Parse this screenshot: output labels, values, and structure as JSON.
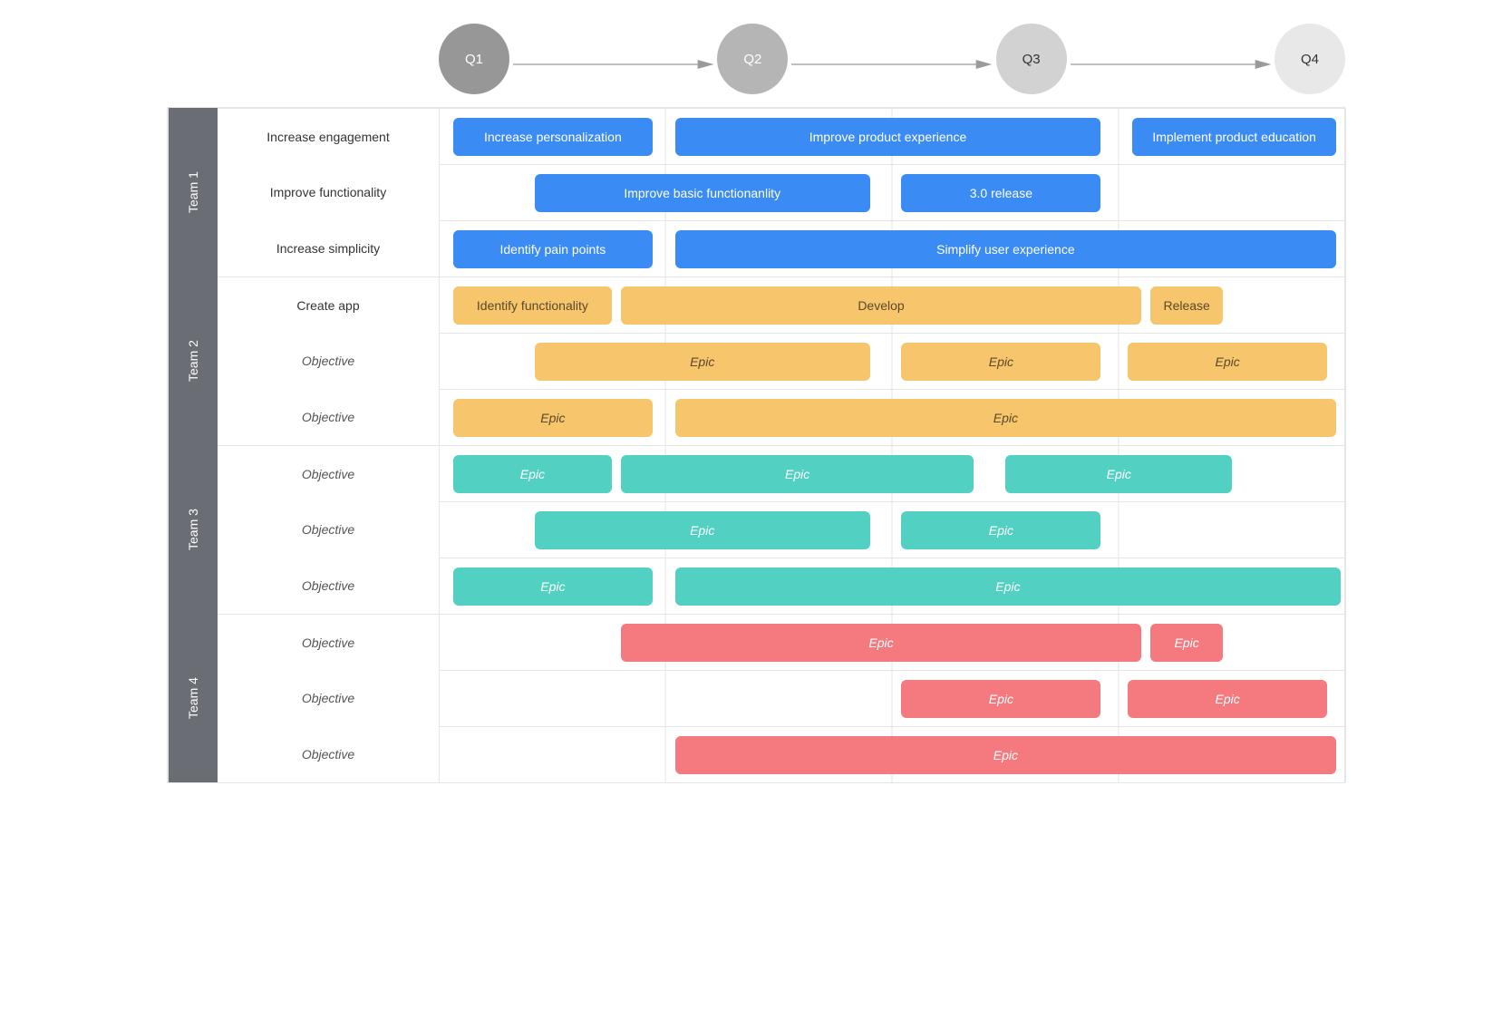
{
  "quarters": [
    "Q1",
    "Q2",
    "Q3",
    "Q4"
  ],
  "teams": [
    {
      "name": "Team 1",
      "color": "c-blue",
      "rows": [
        {
          "objective": "Increase engagement",
          "italic": false,
          "alt": true,
          "epics": [
            {
              "label": "Increase personalization",
              "start": 0.015,
              "span": 0.22,
              "italic": false
            },
            {
              "label": "Improve product experience",
              "start": 0.26,
              "span": 0.47,
              "italic": false
            },
            {
              "label": "Implement product education",
              "start": 0.765,
              "span": 0.225,
              "italic": false
            }
          ]
        },
        {
          "objective": "Improve functionality",
          "italic": false,
          "alt": false,
          "epics": [
            {
              "label": "Improve basic functionanlity",
              "start": 0.105,
              "span": 0.37,
              "italic": false
            },
            {
              "label": "3.0 release",
              "start": 0.51,
              "span": 0.22,
              "italic": false
            }
          ]
        },
        {
          "objective": "Increase simplicity",
          "italic": false,
          "alt": true,
          "epics": [
            {
              "label": "Identify pain points",
              "start": 0.015,
              "span": 0.22,
              "italic": false
            },
            {
              "label": "Simplify user experience",
              "start": 0.26,
              "span": 0.73,
              "italic": false
            }
          ]
        }
      ]
    },
    {
      "name": "Team 2",
      "color": "c-yellow",
      "rows": [
        {
          "objective": "Create app",
          "italic": false,
          "alt": false,
          "epics": [
            {
              "label": "Identify functionality",
              "start": 0.015,
              "span": 0.175,
              "italic": false
            },
            {
              "label": "Develop",
              "start": 0.2,
              "span": 0.575,
              "italic": false
            },
            {
              "label": "Release",
              "start": 0.785,
              "span": 0.08,
              "italic": false
            }
          ]
        },
        {
          "objective": "Objective",
          "italic": true,
          "alt": true,
          "epics": [
            {
              "label": "Epic",
              "start": 0.105,
              "span": 0.37,
              "italic": true
            },
            {
              "label": "Epic",
              "start": 0.51,
              "span": 0.22,
              "italic": true
            },
            {
              "label": "Epic",
              "start": 0.76,
              "span": 0.22,
              "italic": true
            }
          ]
        },
        {
          "objective": "Objective",
          "italic": true,
          "alt": false,
          "epics": [
            {
              "label": "Epic",
              "start": 0.015,
              "span": 0.22,
              "italic": true
            },
            {
              "label": "Epic",
              "start": 0.26,
              "span": 0.73,
              "italic": true
            }
          ]
        }
      ]
    },
    {
      "name": "Team 3",
      "color": "c-teal",
      "rows": [
        {
          "objective": "Objective",
          "italic": true,
          "alt": true,
          "epics": [
            {
              "label": "Epic",
              "start": 0.015,
              "span": 0.175,
              "italic": true
            },
            {
              "label": "Epic",
              "start": 0.2,
              "span": 0.39,
              "italic": true
            },
            {
              "label": "Epic",
              "start": 0.625,
              "span": 0.25,
              "italic": true
            }
          ]
        },
        {
          "objective": "Objective",
          "italic": true,
          "alt": false,
          "epics": [
            {
              "label": "Epic",
              "start": 0.105,
              "span": 0.37,
              "italic": true
            },
            {
              "label": "Epic",
              "start": 0.51,
              "span": 0.22,
              "italic": true
            }
          ]
        },
        {
          "objective": "Objective",
          "italic": true,
          "alt": true,
          "epics": [
            {
              "label": "Epic",
              "start": 0.015,
              "span": 0.22,
              "italic": true
            },
            {
              "label": "Epic",
              "start": 0.26,
              "span": 0.735,
              "italic": true
            }
          ]
        }
      ]
    },
    {
      "name": "Team 4",
      "color": "c-red",
      "rows": [
        {
          "objective": "Objective",
          "italic": true,
          "alt": false,
          "epics": [
            {
              "label": "Epic",
              "start": 0.2,
              "span": 0.575,
              "italic": true
            },
            {
              "label": "Epic",
              "start": 0.785,
              "span": 0.08,
              "italic": true
            }
          ]
        },
        {
          "objective": "Objective",
          "italic": true,
          "alt": true,
          "epics": [
            {
              "label": "Epic",
              "start": 0.51,
              "span": 0.22,
              "italic": true
            },
            {
              "label": "Epic",
              "start": 0.76,
              "span": 0.22,
              "italic": true
            }
          ]
        },
        {
          "objective": "Objective",
          "italic": true,
          "alt": false,
          "epics": [
            {
              "label": "Epic",
              "start": 0.26,
              "span": 0.73,
              "italic": true
            }
          ]
        }
      ]
    }
  ]
}
